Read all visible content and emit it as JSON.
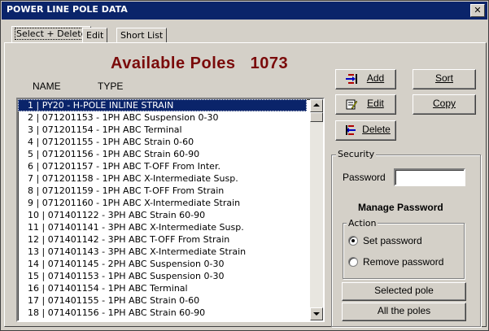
{
  "window": {
    "title": "POWER LINE POLE DATA",
    "close_glyph": "✕"
  },
  "tabs": [
    {
      "label": "Select + Delete",
      "active": true
    },
    {
      "label": "Edit",
      "active": false
    },
    {
      "label": "Short List",
      "active": false
    }
  ],
  "heading": {
    "text": "Available Poles",
    "count": "1073"
  },
  "columns": {
    "name": "NAME",
    "type": "TYPE"
  },
  "list": {
    "selected_index": 0,
    "items": [
      "1 | PY20 - H-POLE INLINE STRAIN",
      "2 | 071201153 - 1PH ABC Suspension 0-30",
      "3 | 071201154 - 1PH ABC Terminal",
      "4 | 071201155 - 1PH ABC Strain 0-60",
      "5 | 071201156 - 1PH ABC Strain 60-90",
      "6 | 071201157 - 1PH ABC T-OFF From Inter.",
      "7 | 071201158 - 1PH ABC X-Intermediate Susp.",
      "8 | 071201159 - 1PH ABC T-OFF From Strain",
      "9 | 071201160 - 1PH ABC X-Intermediate Strain",
      "10 | 071401122 - 3PH ABC Strain 60-90",
      "11 | 071401141 - 3PH ABC X-Intermediate Susp.",
      "12 | 071401142 - 3PH ABC T-OFF From Strain",
      "13 | 071401143 - 3PH ABC X-Intermediate Strain",
      "14 | 071401145 - 2PH ABC Suspension 0-30",
      "15 | 071401153 - 1PH ABC Suspension 0-30",
      "16 | 071401154 - 1PH ABC Terminal",
      "17 | 071401155 - 1PH ABC Strain 0-60",
      "18 | 071401156 - 1PH ABC Strain 60-90"
    ]
  },
  "buttons": {
    "add": "Add",
    "edit": "Edit",
    "delete": "Delete",
    "sort": "Sort",
    "copy": "Copy",
    "selected_pole": "Selected pole",
    "all_poles": "All the poles"
  },
  "security": {
    "group_label": "Security",
    "password_label": "Password",
    "password_value": "",
    "manage_label": "Manage Password",
    "action_label": "Action",
    "options": [
      {
        "label": "Set password",
        "checked": true
      },
      {
        "label": "Remove password",
        "checked": false
      }
    ]
  },
  "colors": {
    "title_bar": "#0a246a",
    "heading": "#7a0a0a",
    "selection": "#0a246a",
    "face": "#d4d0c8"
  },
  "icons": {
    "add": "add-record-icon",
    "edit": "edit-record-icon",
    "delete": "delete-record-icon"
  }
}
